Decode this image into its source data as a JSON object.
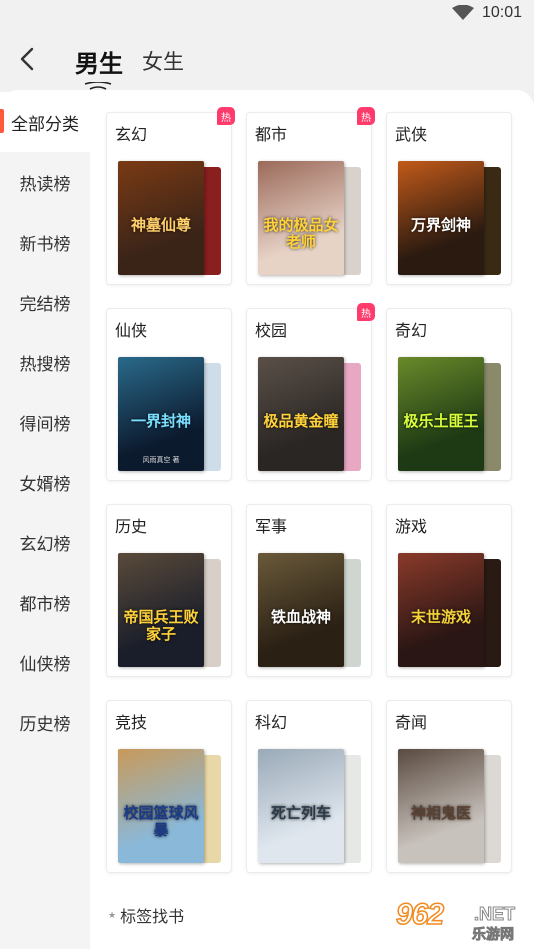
{
  "status": {
    "time": "10:01",
    "wifi_icon": "wifi-icon"
  },
  "header": {
    "back_icon": "chevron-left-icon",
    "tabs": [
      {
        "label": "男生",
        "active": true
      },
      {
        "label": "女生",
        "active": false
      }
    ]
  },
  "sidebar": {
    "items": [
      {
        "label": "全部分类",
        "active": true
      },
      {
        "label": "热读榜"
      },
      {
        "label": "新书榜"
      },
      {
        "label": "完结榜"
      },
      {
        "label": "热搜榜"
      },
      {
        "label": "得间榜"
      },
      {
        "label": "女婿榜"
      },
      {
        "label": "玄幻榜"
      },
      {
        "label": "都市榜"
      },
      {
        "label": "仙侠榜"
      },
      {
        "label": "历史榜"
      }
    ],
    "accent": "#ff5a3c"
  },
  "categories": [
    {
      "label": "玄幻",
      "hot": true,
      "cover_title": "神墓仙尊",
      "cover_author": "",
      "front": "#3a2418",
      "front2": "#7a3a14",
      "title_color": "#ffcf6a",
      "back": "#8a1f1f"
    },
    {
      "label": "都市",
      "hot": true,
      "cover_title": "我的极品女老师",
      "cover_author": "",
      "front": "#e7d2c6",
      "front2": "#9b6a5a",
      "title_color": "#ffd23a",
      "back": "#d9d2cc"
    },
    {
      "label": "武侠",
      "hot": false,
      "cover_title": "万界剑神",
      "cover_author": "",
      "front": "#2a1a10",
      "front2": "#c25a1a",
      "title_color": "#ffffff",
      "back": "#3a2a14"
    },
    {
      "label": "仙侠",
      "hot": false,
      "cover_title": "一界封神",
      "cover_author": "风雨真空 著",
      "front": "#0c1a2e",
      "front2": "#2a6a8a",
      "title_color": "#7ae0ff",
      "back": "#cfdde8"
    },
    {
      "label": "校园",
      "hot": true,
      "cover_title": "极品黄金瞳",
      "cover_author": "",
      "front": "#2a2624",
      "front2": "#5a5048",
      "title_color": "#ffd23a",
      "back": "#e8a8c4"
    },
    {
      "label": "奇幻",
      "hot": false,
      "cover_title": "极乐土匪王",
      "cover_author": "",
      "front": "#1e3a14",
      "front2": "#6a8a2a",
      "title_color": "#d8ff3a",
      "back": "#8a8a6a"
    },
    {
      "label": "历史",
      "hot": false,
      "cover_title": "帝国兵王败家子",
      "cover_author": "",
      "front": "#1a1e2a",
      "front2": "#5a4a3a",
      "title_color": "#ffd23a",
      "back": "#d8d0c8"
    },
    {
      "label": "军事",
      "hot": false,
      "cover_title": "铁血战神",
      "cover_author": "",
      "front": "#2a2014",
      "front2": "#6a5a3a",
      "title_color": "#ffffff",
      "back": "#cfd6cf"
    },
    {
      "label": "游戏",
      "hot": false,
      "cover_title": "末世游戏",
      "cover_author": "",
      "front": "#2a1614",
      "front2": "#8a3a2a",
      "title_color": "#f4d23a",
      "back": "#2a1a14"
    },
    {
      "label": "竞技",
      "hot": false,
      "cover_title": "校园篮球风暴",
      "cover_author": "",
      "front": "#8ab8d8",
      "front2": "#c89a5a",
      "title_color": "#1a3a8a",
      "back": "#e8d8a8"
    },
    {
      "label": "科幻",
      "hot": false,
      "cover_title": "死亡列车",
      "cover_author": "",
      "front": "#dfe6ee",
      "front2": "#9aaab8",
      "title_color": "#2a3a4a",
      "back": "#e6e8e6"
    },
    {
      "label": "奇闻",
      "hot": false,
      "cover_title": "神相鬼医",
      "cover_author": "",
      "front": "#c8c2bc",
      "front2": "#5a4a40",
      "title_color": "#5a4030",
      "back": "#dcd8d4"
    }
  ],
  "hot_label": "热",
  "tag_section": {
    "label": "标签找书"
  },
  "watermark": {
    "number": "962",
    "suffix": ".NET",
    "site_cn": "乐游网"
  }
}
